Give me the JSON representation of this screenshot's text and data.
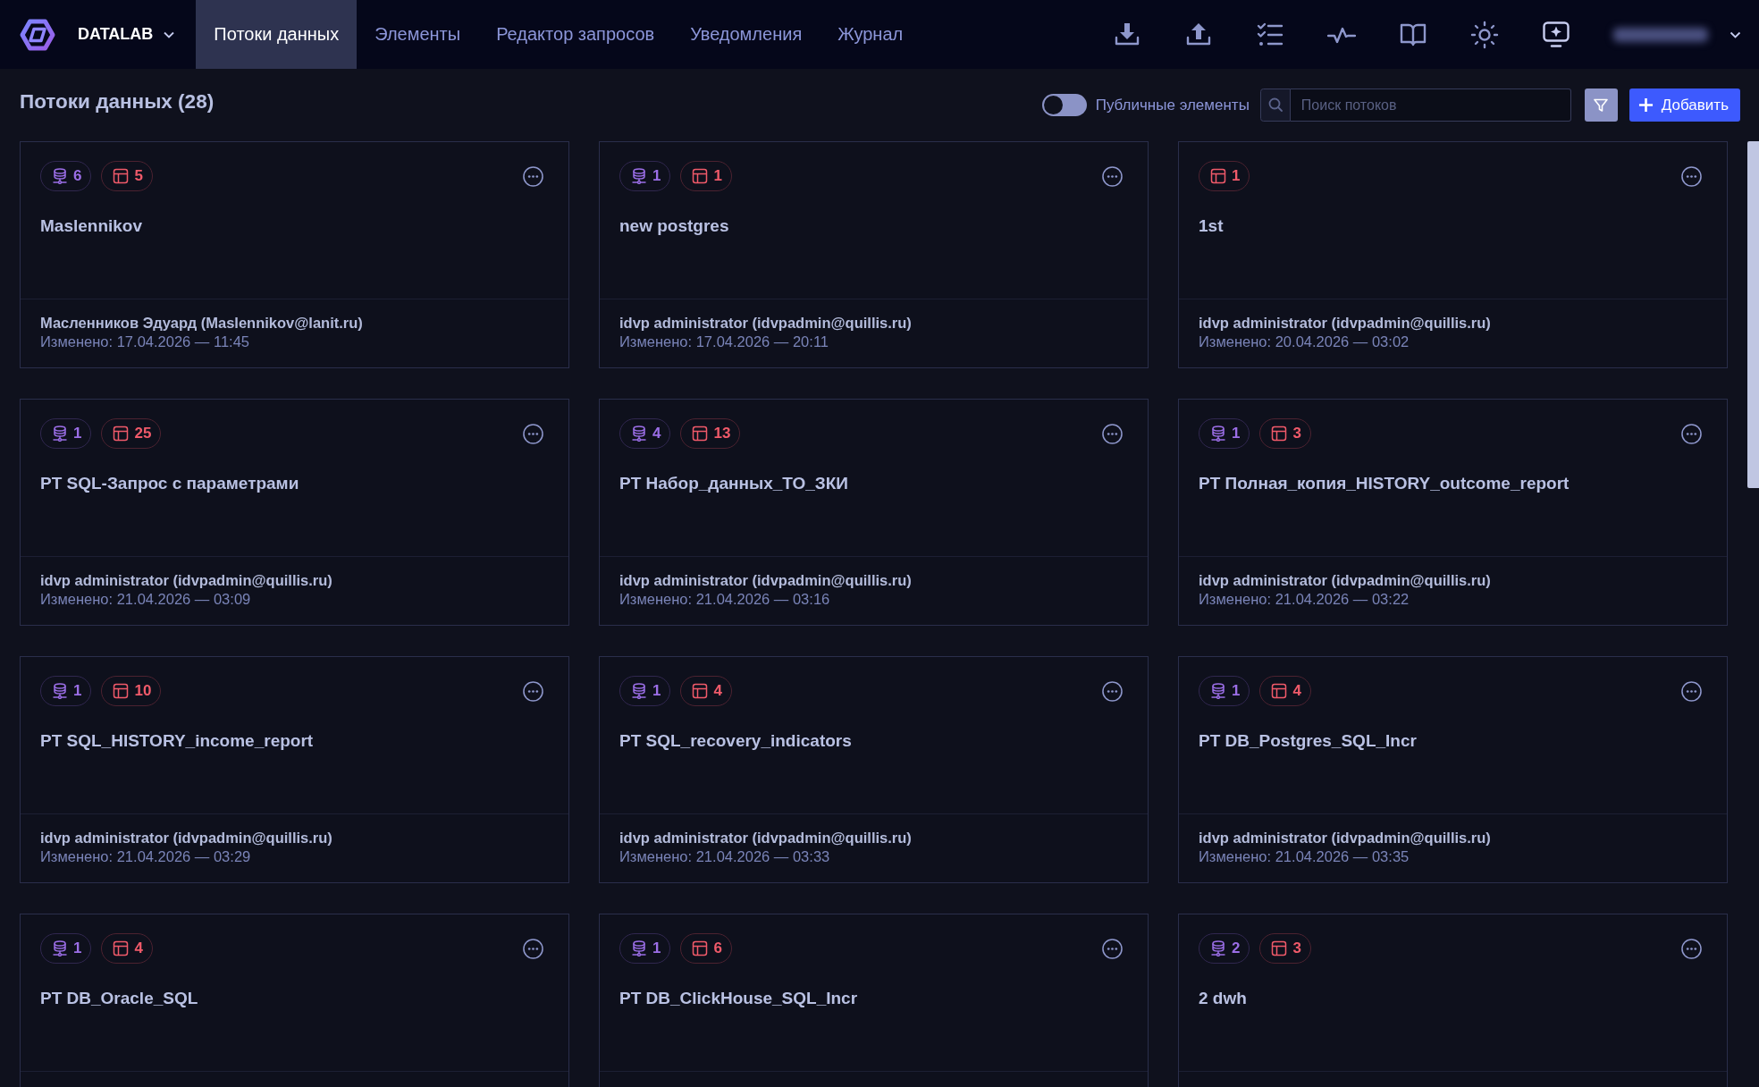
{
  "nav": {
    "brand": "DATALAB",
    "tabs": [
      {
        "label": "Потоки данных",
        "selected": true
      },
      {
        "label": "Элементы",
        "selected": false
      },
      {
        "label": "Редактор запросов",
        "selected": false
      },
      {
        "label": "Уведомления",
        "selected": false
      },
      {
        "label": "Журнал",
        "selected": false
      }
    ]
  },
  "header": {
    "title": "Потоки данных (28)",
    "public_toggle": {
      "label": "Публичные элементы",
      "on": false
    },
    "search": {
      "placeholder": "Поиск потоков"
    },
    "add_button": {
      "label": "Добавить"
    }
  },
  "cards": [
    {
      "badges": [
        {
          "kind": "source",
          "count": "6"
        },
        {
          "kind": "table",
          "count": "5"
        }
      ],
      "title": "Maslennikov",
      "author": "Масленников Эдуард (Maslennikov@lanit.ru)",
      "modified": "Изменено: 17.04.2026 — 11:45"
    },
    {
      "badges": [
        {
          "kind": "source",
          "count": "1"
        },
        {
          "kind": "table",
          "count": "1"
        }
      ],
      "title": "new postgres",
      "author": "idvp administrator (idvpadmin@quillis.ru)",
      "modified": "Изменено: 17.04.2026 — 20:11"
    },
    {
      "badges": [
        {
          "kind": "table",
          "count": "1"
        }
      ],
      "title": "1st",
      "author": "idvp administrator (idvpadmin@quillis.ru)",
      "modified": "Изменено: 20.04.2026 — 03:02"
    },
    {
      "badges": [
        {
          "kind": "source",
          "count": "1"
        },
        {
          "kind": "table",
          "count": "25"
        }
      ],
      "title": "PT SQL-Запрос с параметрами",
      "author": "idvp administrator (idvpadmin@quillis.ru)",
      "modified": "Изменено: 21.04.2026 — 03:09"
    },
    {
      "badges": [
        {
          "kind": "source",
          "count": "4"
        },
        {
          "kind": "table",
          "count": "13"
        }
      ],
      "title": "PT Набор_данных_ТО_ЗКИ",
      "author": "idvp administrator (idvpadmin@quillis.ru)",
      "modified": "Изменено: 21.04.2026 — 03:16"
    },
    {
      "badges": [
        {
          "kind": "source",
          "count": "1"
        },
        {
          "kind": "table",
          "count": "3"
        }
      ],
      "title": "PT Полная_копия_HISTORY_outcome_report",
      "author": "idvp administrator (idvpadmin@quillis.ru)",
      "modified": "Изменено: 21.04.2026 — 03:22"
    },
    {
      "badges": [
        {
          "kind": "source",
          "count": "1"
        },
        {
          "kind": "table",
          "count": "10"
        }
      ],
      "title": "PT SQL_HISTORY_income_report",
      "author": "idvp administrator (idvpadmin@quillis.ru)",
      "modified": "Изменено: 21.04.2026 — 03:29"
    },
    {
      "badges": [
        {
          "kind": "source",
          "count": "1"
        },
        {
          "kind": "table",
          "count": "4"
        }
      ],
      "title": "PT SQL_recovery_indicators",
      "author": "idvp administrator (idvpadmin@quillis.ru)",
      "modified": "Изменено: 21.04.2026 — 03:33"
    },
    {
      "badges": [
        {
          "kind": "source",
          "count": "1"
        },
        {
          "kind": "table",
          "count": "4"
        }
      ],
      "title": "PT DB_Postgres_SQL_Incr",
      "author": "idvp administrator (idvpadmin@quillis.ru)",
      "modified": "Изменено: 21.04.2026 — 03:35"
    },
    {
      "badges": [
        {
          "kind": "source",
          "count": "1"
        },
        {
          "kind": "table",
          "count": "4"
        }
      ],
      "title": "PT DB_Oracle_SQL"
    },
    {
      "badges": [
        {
          "kind": "source",
          "count": "1"
        },
        {
          "kind": "table",
          "count": "6"
        }
      ],
      "title": "PT DB_ClickHouse_SQL_Incr"
    },
    {
      "badges": [
        {
          "kind": "source",
          "count": "2"
        },
        {
          "kind": "table",
          "count": "3"
        }
      ],
      "title": "2 dwh"
    }
  ]
}
